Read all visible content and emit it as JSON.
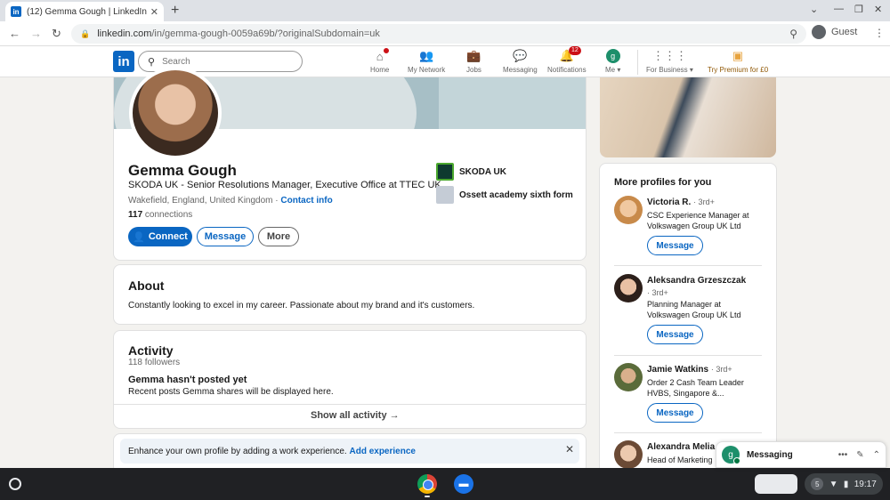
{
  "browser": {
    "tab_title": "(12) Gemma Gough | LinkedIn",
    "tab_favicon": "in",
    "url_host": "linkedin.com",
    "url_path": "/in/gemma-gough-0059a69b/?originalSubdomain=uk",
    "profile_label": "Guest"
  },
  "linkedin": {
    "logo": "in",
    "search_placeholder": "Search",
    "nav": {
      "home": "Home",
      "network": "My Network",
      "jobs": "Jobs",
      "messaging": "Messaging",
      "notifications": "Notifications",
      "notifications_count": "12",
      "me": "Me",
      "me_initial": "g",
      "business": "For Business",
      "premium": "Try Premium for £0"
    }
  },
  "profile": {
    "name": "Gemma Gough",
    "headline": "SKODA UK - Senior Resolutions Manager, Executive Office at TTEC UK",
    "location": "Wakefield, England, United Kingdom",
    "contact_link": "Contact info",
    "connections_count": "117",
    "connections_label": "connections",
    "buttons": {
      "connect": "Connect",
      "message": "Message",
      "more": "More"
    },
    "orgs": [
      "SKODA UK",
      "Ossett academy sixth form"
    ]
  },
  "about": {
    "title": "About",
    "text": "Constantly looking to excel in my career. Passionate about my brand and it's customers."
  },
  "activity": {
    "title": "Activity",
    "followers": "118 followers",
    "empty_title": "Gemma hasn't posted yet",
    "empty_text": "Recent posts Gemma shares will be displayed here.",
    "show_all": "Show all activity"
  },
  "experience_prompt": {
    "text": "Enhance your own profile by adding a work experience.",
    "link": "Add experience"
  },
  "right_rail": {
    "title": "More profiles for you",
    "message_label": "Message",
    "people": [
      {
        "name": "Victoria R.",
        "degree": "· 3rd+",
        "title_line1": "CSC Experience Manager at",
        "title_line2": "Volkswagen Group UK Ltd"
      },
      {
        "name": "Aleksandra Grzeszczak",
        "degree": "· 3rd+",
        "title_line1": "Planning Manager at",
        "title_line2": "Volkswagen Group UK Ltd"
      },
      {
        "name": "Jamie Watkins",
        "degree": "· 3rd+",
        "title_line1": "Order 2 Cash Team Leader",
        "title_line2": "HVBS, Singapore &..."
      },
      {
        "name": "Alexandra Melia",
        "degree": "",
        "title_line1": "Head of Marketing",
        "title_line2": ""
      }
    ]
  },
  "messaging_widget": {
    "title": "Messaging",
    "initial": "g"
  },
  "shelf": {
    "clock": "19:17",
    "badge": "5"
  },
  "colors": {
    "brand": "#0a66c2",
    "badge": "#cc1016"
  }
}
